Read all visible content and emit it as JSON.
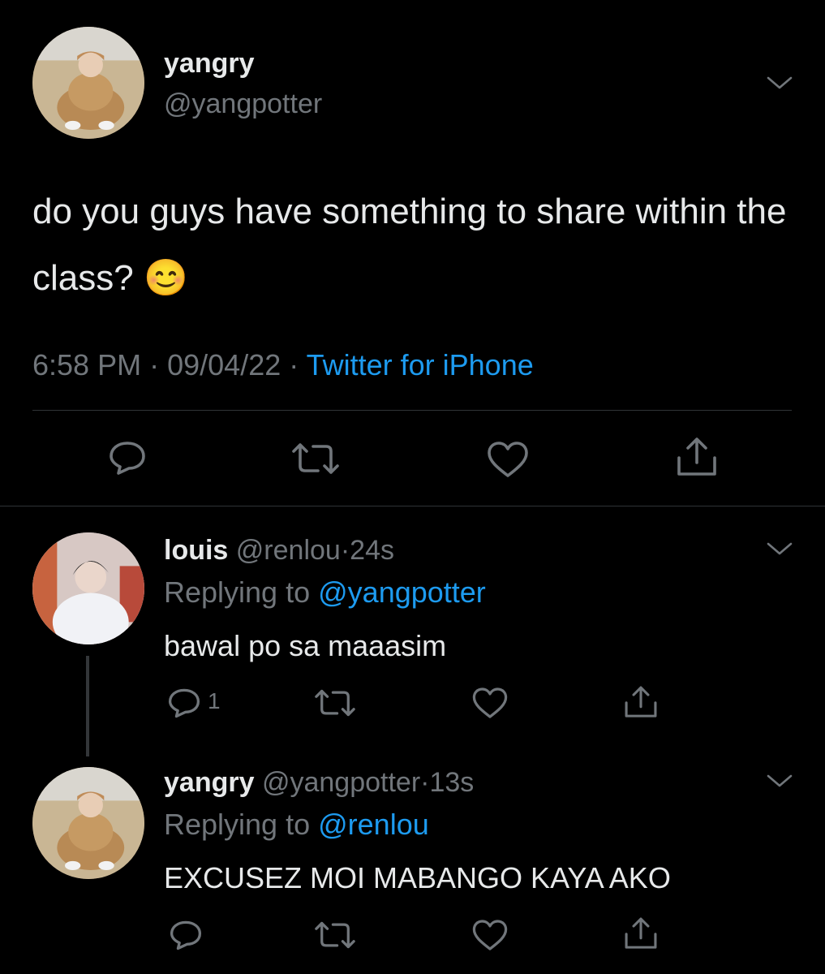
{
  "main_tweet": {
    "display_name": "yangry",
    "handle": "@yangpotter",
    "text": "do you guys have something to share within the class?",
    "emoji": "😊",
    "time": "6:58 PM",
    "date": "09/04/22",
    "source": "Twitter for iPhone",
    "sep": "·"
  },
  "replies": [
    {
      "display_name": "louis",
      "handle": "@renlou",
      "sep": "·",
      "age": "24s",
      "replying_label": "Replying to",
      "replying_to": "@yangpotter",
      "text": "bawal po sa maaasim",
      "reply_count": "1"
    },
    {
      "display_name": "yangry",
      "handle": "@yangpotter",
      "sep": "·",
      "age": "13s",
      "replying_label": "Replying to",
      "replying_to": "@renlou",
      "text": "EXCUSEZ MOI MABANGO KAYA AKO",
      "reply_count": ""
    }
  ],
  "colors": {
    "background": "#000000",
    "text": "#e7e9ea",
    "muted": "#71767b",
    "link": "#1d9bf0",
    "divider": "#2f3336"
  },
  "icons": [
    "chevron-down-icon",
    "reply-icon",
    "retweet-icon",
    "like-icon",
    "share-icon"
  ]
}
